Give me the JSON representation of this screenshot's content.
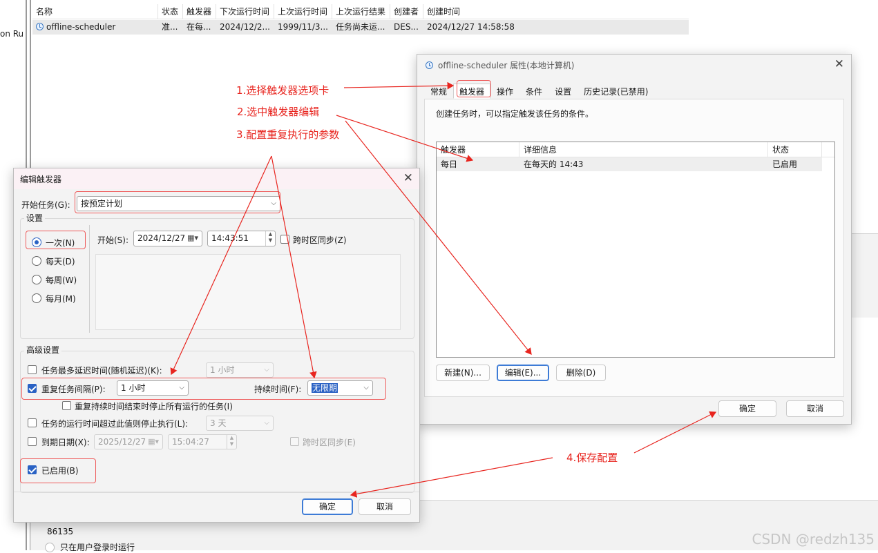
{
  "background": {
    "left_clip_text": "on Ru",
    "columns": [
      "名称",
      "状态",
      "触发器",
      "下次运行时间",
      "上次运行时间",
      "上次运行结果",
      "创建者",
      "创建时间"
    ],
    "row": [
      "offline-scheduler",
      "准...",
      "在每...",
      "2024/12/2...",
      "1999/11/3...",
      "任务尚未运...",
      "DES...",
      "2024/12/27 14:58:58"
    ],
    "bottom_id": "86135",
    "bottom_option": "只在用户登录时运行"
  },
  "props_dialog": {
    "title": "offline-scheduler 属性(本地计算机)",
    "tabs": [
      "常规",
      "触发器",
      "操作",
      "条件",
      "设置",
      "历史记录(已禁用)"
    ],
    "active_tab": "触发器",
    "description": "创建任务时，可以指定触发该任务的条件。",
    "table_columns": [
      "触发器",
      "详细信息",
      "状态"
    ],
    "table_row": [
      "每日",
      "在每天的 14:43",
      "已启用"
    ],
    "btn_new": "新建(N)...",
    "btn_edit": "编辑(E)...",
    "btn_delete": "删除(D)",
    "btn_ok": "确定",
    "btn_cancel": "取消"
  },
  "edit_dialog": {
    "title": "编辑触发器",
    "start_task_label": "开始任务(G):",
    "start_task_value": "按预定计划",
    "settings_label": "设置",
    "radios": [
      "一次(N)",
      "每天(D)",
      "每周(W)",
      "每月(M)"
    ],
    "selected_radio": "一次(N)",
    "start_label": "开始(S):",
    "start_date": "2024/12/27",
    "start_time": "14:43:51",
    "sync_tz_label": "跨时区同步(Z)",
    "advanced_label": "高级设置",
    "delay_label": "任务最多延迟时间(随机延迟)(K):",
    "delay_value": "1 小时",
    "repeat_label": "重复任务间隔(P):",
    "repeat_value": "1 小时",
    "duration_label": "持续时间(F):",
    "duration_value": "无限期",
    "stop_at_end_label": "重复持续时间结束时停止所有运行的任务(I)",
    "stop_if_longer_label": "任务的运行时间超过此值则停止执行(L):",
    "stop_if_longer_value": "3 天",
    "expire_label": "到期日期(X):",
    "expire_date": "2025/12/27",
    "expire_time": "15:04:27",
    "expire_sync_label": "跨时区同步(E)",
    "enabled_label": "已启用(B)",
    "btn_ok": "确定",
    "btn_cancel": "取消"
  },
  "annotations": {
    "step1": "1.选择触发器选项卡",
    "step2": "2.选中触发器编辑",
    "step3": "3.配置重复执行的参数",
    "step4": "4.保存配置"
  },
  "colors": {
    "annotation_red": "#e8251f",
    "accent_blue": "#2a62c4"
  },
  "watermark": "CSDN @redzh135"
}
